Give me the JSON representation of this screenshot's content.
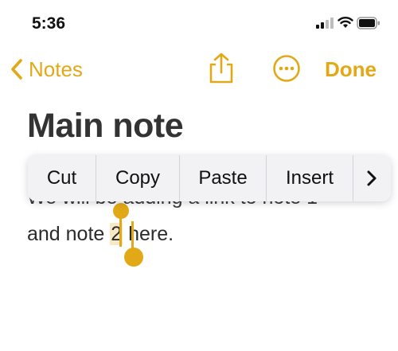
{
  "status": {
    "time": "5:36"
  },
  "nav": {
    "back_label": "Notes",
    "done_label": "Done"
  },
  "note": {
    "title": "Main note",
    "line1": "We will be adding a link to note 1",
    "line2_before": "and note ",
    "line2_selected": "2",
    "line2_after": " here."
  },
  "context_menu": {
    "items": [
      "Cut",
      "Copy",
      "Paste",
      "Insert"
    ]
  },
  "colors": {
    "accent": "#e1a917",
    "text": "#333333",
    "menu_bg": "#f2f2f4"
  }
}
